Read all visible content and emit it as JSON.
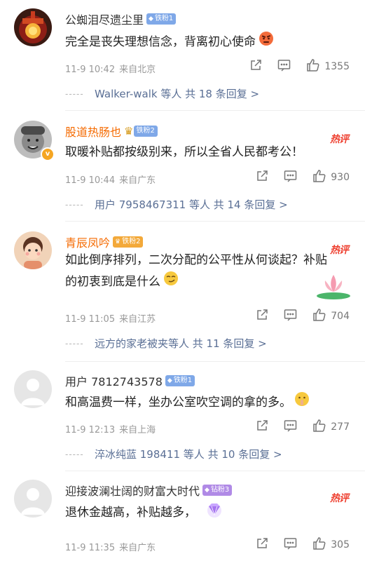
{
  "comments": [
    {
      "username": "公蜘泪尽遗尘里",
      "fan_badge": "铁粉1",
      "text": "完全是丧失理想信念，背离初心使命",
      "emoji": "angry-face",
      "time": "11-9 10:42",
      "location": "来自北京",
      "likes": "1355",
      "replies": "Walker-walk 等人  共 18 条回复 >"
    },
    {
      "username": "股道热肠也",
      "fan_badge": "铁粉2",
      "hot": "热评",
      "text": "取暖补贴都按级别来，所以全省人民都考公！",
      "time": "11-9 10:44",
      "location": "来自广东",
      "likes": "930",
      "replies": "用户 7958467311 等人  共 14 条回复 >"
    },
    {
      "username": "青辰凤吟",
      "fan_badge": "铁粉2",
      "hot": "热评",
      "text": "如此倒序排列，二次分配的公平性从何谈起？补贴的初衷到底是什么",
      "emoji": "smirk-face",
      "time": "11-9 11:05",
      "location": "来自江苏",
      "likes": "704",
      "replies": "远方的家老被夹等人  共 11 条回复 >"
    },
    {
      "username": "用户 7812743578",
      "fan_badge": "铁粉1",
      "text": "和高温费一样，坐办公室吹空调的拿的多。",
      "emoji": "shush-face",
      "time": "11-9 12:13",
      "location": "来自上海",
      "likes": "277",
      "replies": "淬冰纯蓝 198411 等人  共 10 条回复 >"
    },
    {
      "username": "迎接波澜壮阔的财富大时代",
      "fan_badge": "钻粉3",
      "hot": "热评",
      "text": "退休金越高，补贴越多，",
      "emoji": "diamond",
      "time": "11-9 11:35",
      "location": "来自广东",
      "likes": "305"
    }
  ],
  "colors": {
    "hot": "#ee3f2f",
    "vip_name": "#f56a00",
    "reply_link": "#5a6f95",
    "meta": "#999999"
  },
  "icons": [
    "share-icon",
    "comment-icon",
    "like-icon",
    "verified-icon",
    "crown-icon",
    "lotus-sticker"
  ]
}
